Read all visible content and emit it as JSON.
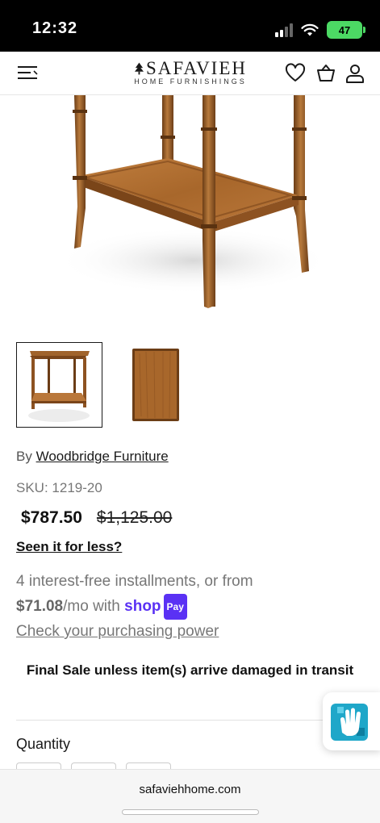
{
  "status_bar": {
    "time": "12:32",
    "battery": "47"
  },
  "header": {
    "logo_text": "SAFAVIEH",
    "logo_subtitle": "HOME FURNISHINGS",
    "icons": [
      "menu-icon",
      "heart-icon",
      "cart-icon",
      "account-icon"
    ]
  },
  "product": {
    "by_label": "By",
    "brand": "Woodbridge Furniture",
    "sku_label": "SKU:",
    "sku": "1219-20",
    "sale_price": "$787.50",
    "original_price": "$1,125.00",
    "seen_it_for_less": "Seen it for less?",
    "installments_text": "4 interest-free installments, or from",
    "installment_amount": "$71.08",
    "installment_suffix": "/mo with",
    "shop_pay_word": "shop",
    "pay_badge": "Pay",
    "check_power": "Check your purchasing power",
    "final_sale": "Final Sale unless item(s) arrive damaged in transit",
    "quantity_label": "Quantity"
  },
  "browser": {
    "url": "safaviehhome.com"
  },
  "colors": {
    "wood": "#a0632c",
    "shop_pay": "#5a31f4",
    "battery": "#4cd964"
  }
}
